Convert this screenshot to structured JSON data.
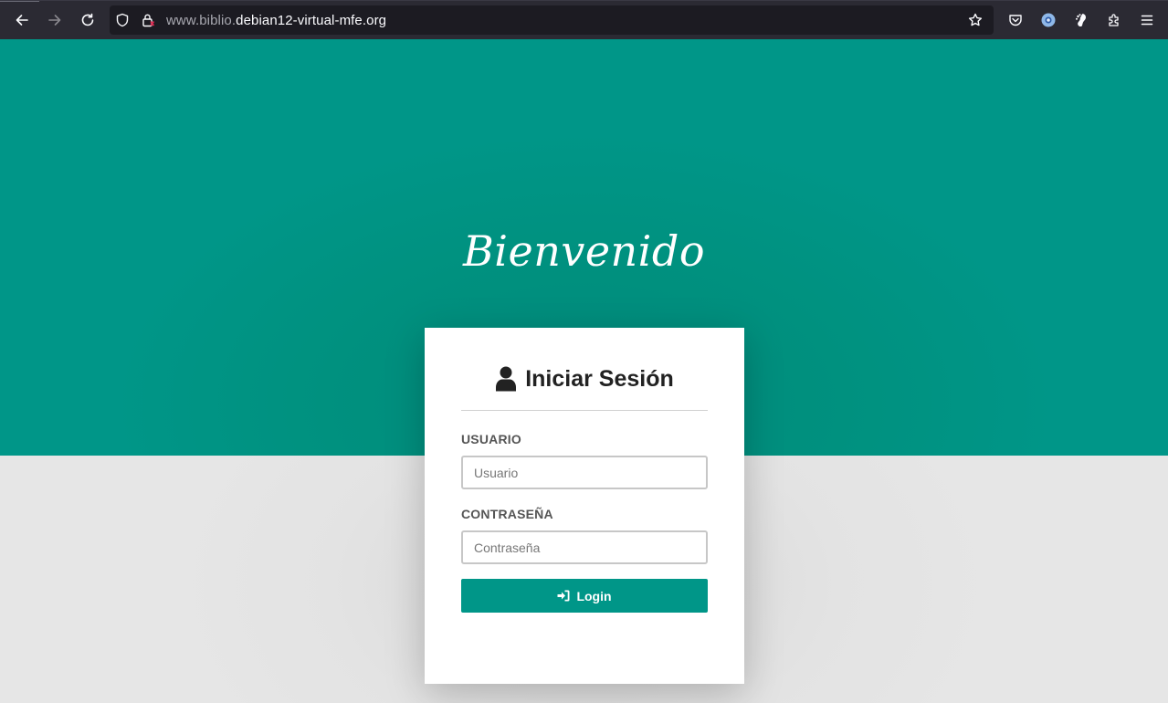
{
  "browser": {
    "url_prefix": "www.biblio.",
    "url_domain": "debian12-virtual-mfe.org",
    "icons": [
      "back-arrow-icon",
      "forward-arrow-icon",
      "reload-icon",
      "shield-icon",
      "lock-icon",
      "star-icon",
      "pocket-icon",
      "extension-blue-icon",
      "gnome-extension-icon",
      "extensions-puzzle-icon",
      "menu-icon"
    ]
  },
  "hero": {
    "welcome_text": "Bienvenido",
    "color": "#009688"
  },
  "login_card": {
    "title": "Iniciar Sesión",
    "title_icon": "user-icon",
    "username_label": "USUARIO",
    "username_placeholder": "Usuario",
    "password_label": "CONTRASEÑA",
    "password_placeholder": "Contraseña",
    "login_button_label": "Login",
    "login_button_icon": "sign-in-icon",
    "accent_color": "#009688"
  }
}
